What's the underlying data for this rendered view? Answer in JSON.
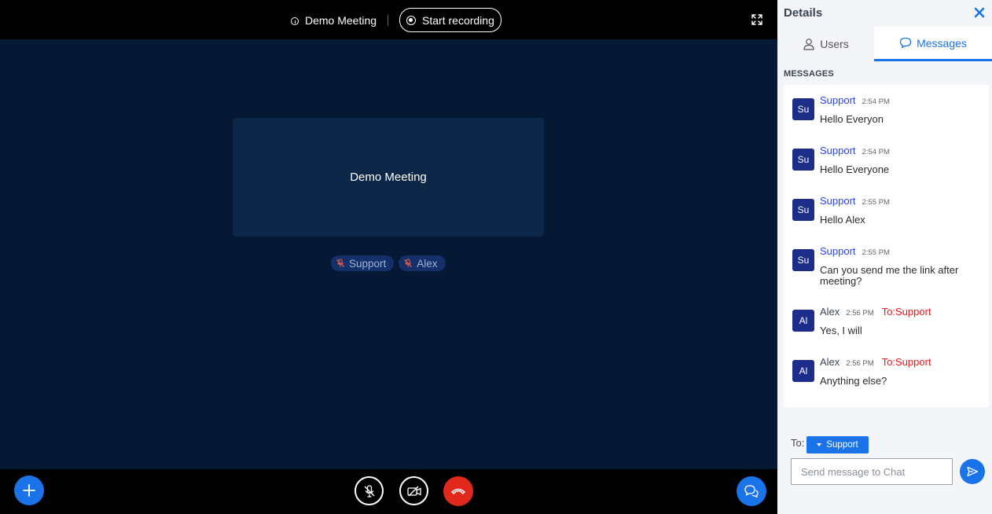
{
  "topbar": {
    "meeting_title": "Demo Meeting",
    "record_label": "Start recording"
  },
  "stage": {
    "presenter_name": "Demo Meeting",
    "participants": [
      {
        "name": "Support",
        "icon": "mic-muted-icon"
      },
      {
        "name": "Alex",
        "icon": "mic-muted-icon"
      }
    ]
  },
  "colors": {
    "accent": "#1a73e8",
    "hangup": "#e0281c",
    "support_name": "#2b44e8",
    "private_target": "#e81c1c"
  },
  "panel": {
    "title": "Details",
    "tabs": [
      {
        "label": "Users",
        "icon": "user-icon"
      },
      {
        "label": "Messages",
        "icon": "chat-bubble-icon",
        "active": true
      }
    ],
    "section_label": "MESSAGES",
    "messages": [
      {
        "avatar": "Su",
        "sender": "Support",
        "time": "2:54 PM",
        "to": "",
        "text": "Hello Everyon"
      },
      {
        "avatar": "Su",
        "sender": "Support",
        "time": "2:54 PM",
        "to": "",
        "text": "Hello Everyone"
      },
      {
        "avatar": "Su",
        "sender": "Support",
        "time": "2:55 PM",
        "to": "",
        "text": "Hello Alex"
      },
      {
        "avatar": "Su",
        "sender": "Support",
        "time": "2:55 PM",
        "to": "",
        "text": "Can you send me the link after meeting?"
      },
      {
        "avatar": "Al",
        "sender": "Alex",
        "time": "2:56 PM",
        "to": "To:Support",
        "text": "Yes, I will"
      },
      {
        "avatar": "Al",
        "sender": "Alex",
        "time": "2:56 PM",
        "to": "To:Support",
        "text": "Anything else?"
      }
    ],
    "compose": {
      "to_label": "To:",
      "recipient": "Support",
      "placeholder": "Send message to Chat",
      "value": ""
    }
  }
}
